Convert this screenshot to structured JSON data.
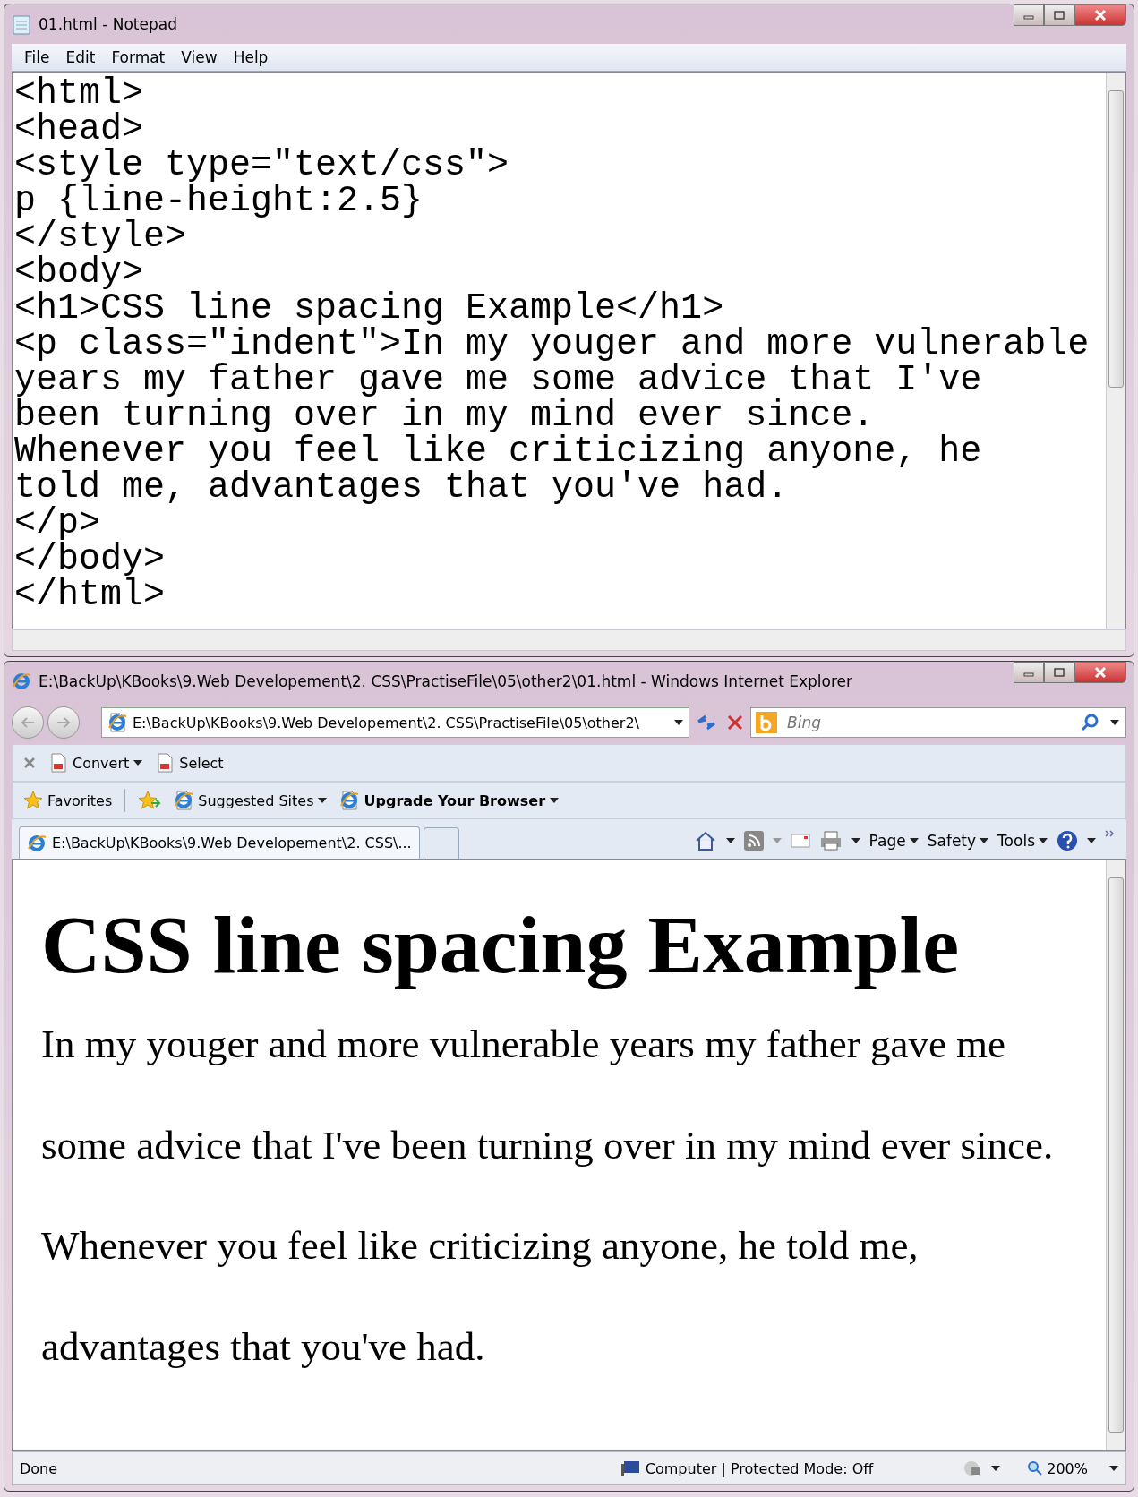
{
  "notepad": {
    "title": "01.html - Notepad",
    "menu": [
      "File",
      "Edit",
      "Format",
      "View",
      "Help"
    ],
    "lines": [
      "<html>",
      "<head>",
      "<style type=\"text/css\">",
      "p {line-height:2.5}",
      "</style>",
      "<body>",
      "<h1>CSS line spacing Example</h1>",
      "<p class=\"indent\">In my youger and more vulnerable",
      "years my father gave me some advice that I've",
      "been turning over in my mind ever since.",
      "Whenever you feel like criticizing anyone, he",
      "told me, advantages that you've had.",
      "</p>",
      "</body>",
      "</html>"
    ]
  },
  "browser": {
    "title": "E:\\BackUp\\KBooks\\9.Web Developement\\2. CSS\\PractiseFile\\05\\other2\\01.html - Windows Internet Explorer",
    "address": "E:\\BackUp\\KBooks\\9.Web Developement\\2. CSS\\PractiseFile\\05\\other2\\",
    "search_placeholder": "Bing",
    "convert_bar": [
      "Convert",
      "Select"
    ],
    "favorites": "Favorites",
    "links": [
      "Suggested Sites",
      "Upgrade Your Browser"
    ],
    "tabs": [
      {
        "label": "E:\\BackUp\\KBooks\\9.Web Developement\\2. CSS\\...",
        "selected": true
      }
    ],
    "commands": [
      "Page",
      "Safety",
      "Tools"
    ],
    "page": {
      "heading": "CSS line spacing Example",
      "paragraph": "In my youger and more vulnerable years my father gave me some advice that I've been turning over in my mind ever since. Whenever you feel like criticizing anyone, he told me, advantages that you've had."
    },
    "status_bar": {
      "text": "Done",
      "zone": "Computer | Protected Mode: Off",
      "zoom": "200%"
    }
  }
}
